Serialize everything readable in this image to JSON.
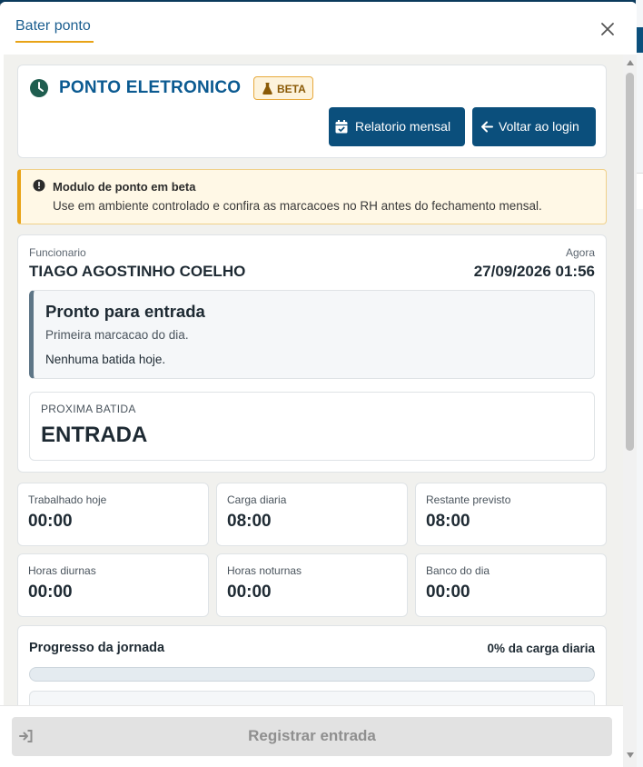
{
  "modal": {
    "title": "Bater ponto"
  },
  "header": {
    "title": "PONTO ELETRONICO",
    "badge": "BETA",
    "report_button": "Relatorio mensal",
    "back_button": "Voltar ao login"
  },
  "alert": {
    "title": "Modulo de ponto em beta",
    "text": "Use em ambiente controlado e confira as marcacoes no RH antes do fechamento mensal."
  },
  "employee": {
    "label": "Funcionario",
    "name": "TIAGO AGOSTINHO COELHO",
    "now_label": "Agora",
    "now_value": "27/09/2026 01:56"
  },
  "status": {
    "title": "Pronto para entrada",
    "subtitle": "Primeira marcacao do dia.",
    "detail": "Nenhuma batida hoje."
  },
  "next_punch": {
    "label": "PROXIMA BATIDA",
    "value": "ENTRADA"
  },
  "stats": [
    {
      "label": "Trabalhado hoje",
      "value": "00:00"
    },
    {
      "label": "Carga diaria",
      "value": "08:00"
    },
    {
      "label": "Restante previsto",
      "value": "08:00"
    },
    {
      "label": "Horas diurnas",
      "value": "00:00"
    },
    {
      "label": "Horas noturnas",
      "value": "00:00"
    },
    {
      "label": "Banco do dia",
      "value": "00:00"
    }
  ],
  "progress": {
    "title": "Progresso da jornada",
    "percent_text": "0% da carga diaria",
    "fraction": 0
  },
  "footer": {
    "register_button": "Registrar entrada"
  },
  "colors": {
    "primary": "#0b4f7c",
    "accent": "#e8a317",
    "title_blue": "#0b5a91",
    "clock_green": "#1f5d4f"
  }
}
